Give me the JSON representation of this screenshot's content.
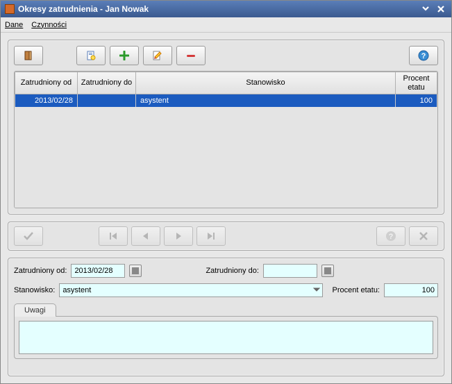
{
  "window": {
    "title": "Okresy zatrudnienia - Jan Nowak"
  },
  "menu": {
    "dane": "Dane",
    "czynnosci": "Czynności"
  },
  "table": {
    "headers": {
      "od": "Zatrudniony od",
      "do": "Zatrudniony do",
      "stan": "Stanowisko",
      "pct": "Procent etatu"
    },
    "rows": [
      {
        "od": "2013/02/28",
        "do": "",
        "stan": "asystent",
        "pct": "100"
      }
    ]
  },
  "form": {
    "od_label": "Zatrudniony od:",
    "od_value": "2013/02/28",
    "do_label": "Zatrudniony do:",
    "do_value": "",
    "stan_label": "Stanowisko:",
    "stan_value": "asystent",
    "pct_label": "Procent etatu:",
    "pct_value": "100",
    "tab_uwagi": "Uwagi",
    "notes": ""
  }
}
